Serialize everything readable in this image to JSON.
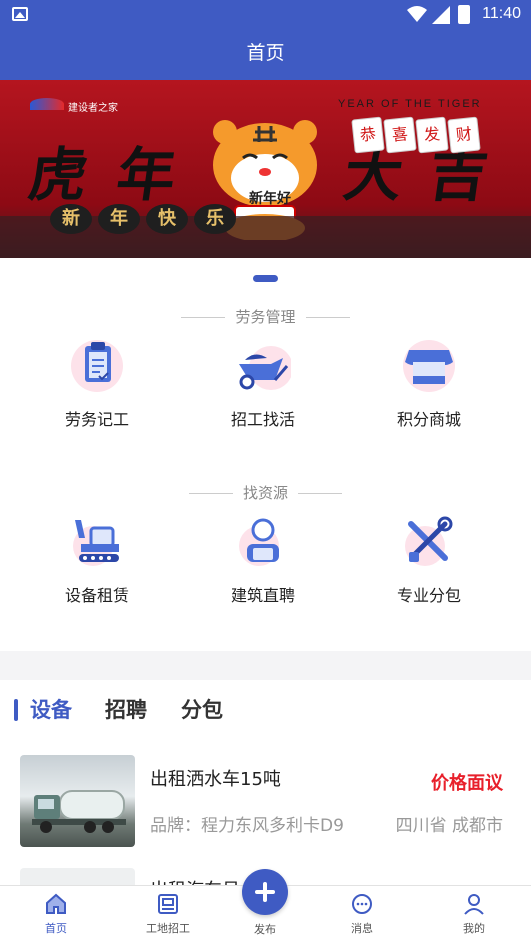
{
  "status_bar": {
    "time": "11:40"
  },
  "app_bar": {
    "title": "首页"
  },
  "banner": {
    "brand": "建设者之家",
    "year_tag": "YEAR OF THE TIGER",
    "headline": [
      "虎",
      "年",
      "大",
      "吉"
    ],
    "tiles": [
      "恭",
      "喜",
      "发",
      "财"
    ],
    "slogan": [
      "新",
      "年",
      "快",
      "乐"
    ],
    "badge": "新年好"
  },
  "labor_section": {
    "title": "劳务管理",
    "items": [
      {
        "label": "劳务记工",
        "icon": "clipboard-icon"
      },
      {
        "label": "招工找活",
        "icon": "wheelbarrow-icon"
      },
      {
        "label": "积分商城",
        "icon": "shop-icon"
      }
    ]
  },
  "resource_section": {
    "title": "找资源",
    "items": [
      {
        "label": "设备租赁",
        "icon": "excavator-icon"
      },
      {
        "label": "建筑直聘",
        "icon": "worker-icon"
      },
      {
        "label": "专业分包",
        "icon": "tools-icon"
      }
    ]
  },
  "tabs": [
    {
      "label": "设备",
      "active": true
    },
    {
      "label": "招聘",
      "active": false
    },
    {
      "label": "分包",
      "active": false
    }
  ],
  "listings": [
    {
      "title": "出租洒水车15吨",
      "price": "价格面议",
      "brand": "品牌：程力东风多利卡D9",
      "location": "四川省 成都市"
    },
    {
      "title": "出租汽车吊"
    }
  ],
  "bottom_nav": [
    {
      "label": "首页",
      "icon": "home-icon",
      "active": true
    },
    {
      "label": "工地招工",
      "icon": "site-icon",
      "active": false
    },
    {
      "label": "发布",
      "icon": "plus-icon",
      "active": false
    },
    {
      "label": "消息",
      "icon": "chat-icon",
      "active": false
    },
    {
      "label": "我的",
      "icon": "user-icon",
      "active": false
    }
  ],
  "colors": {
    "primary": "#3f5bc3",
    "price": "#e8202b",
    "banner": "#b5151f"
  }
}
